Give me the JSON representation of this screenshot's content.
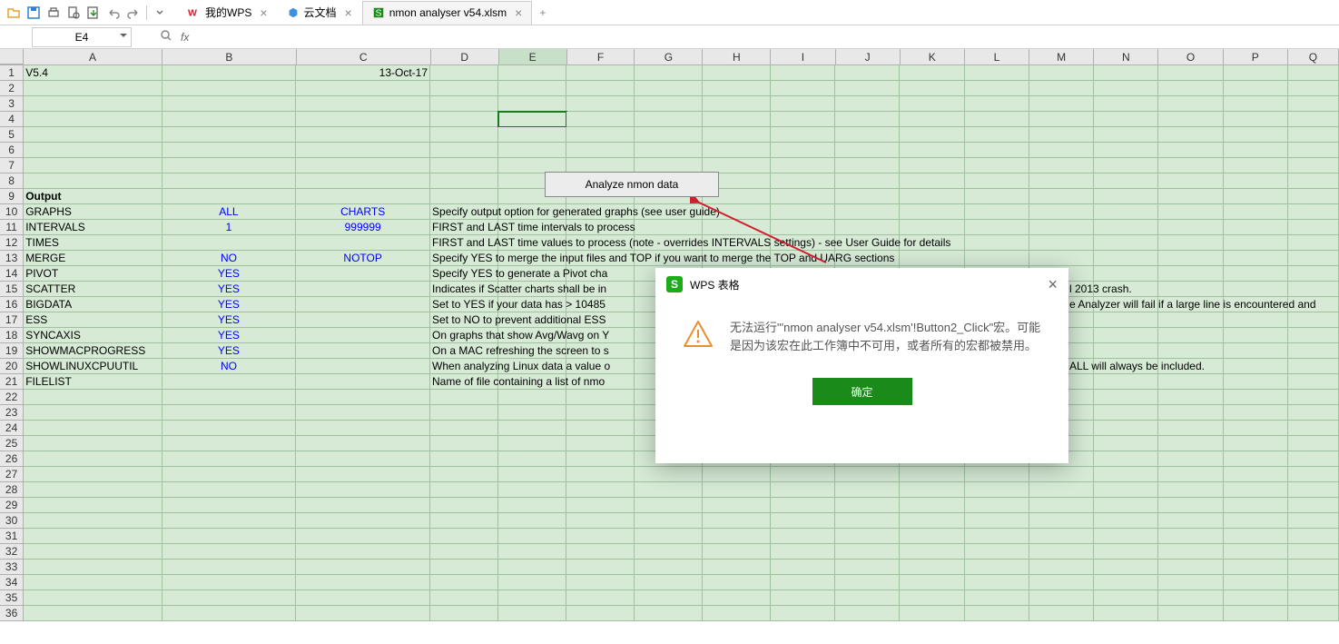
{
  "toolbar": {
    "icons": [
      "open",
      "save",
      "print",
      "export",
      "refresh",
      "undo",
      "redo"
    ]
  },
  "tabs": [
    {
      "label": "我的WPS",
      "type": "wps"
    },
    {
      "label": "云文档",
      "type": "cloud"
    },
    {
      "label": "nmon analyser v54.xlsm",
      "type": "xlsm",
      "active": true
    }
  ],
  "name_box": "E4",
  "columns": [
    "A",
    "B",
    "C",
    "D",
    "E",
    "F",
    "G",
    "H",
    "I",
    "J",
    "K",
    "L",
    "M",
    "N",
    "O",
    "P",
    "Q"
  ],
  "selected_col": "E",
  "selected_row": 4,
  "row_count": 36,
  "cells": {
    "1": {
      "A": "V5.4",
      "C": {
        "v": "13-Oct-17",
        "align": "right"
      }
    },
    "9": {
      "A": {
        "v": "Output",
        "bold": true
      }
    },
    "10": {
      "A": "GRAPHS",
      "B": {
        "v": "ALL",
        "blue": true
      },
      "C": {
        "v": "CHARTS",
        "blue": true
      },
      "D": "Specify output option for generated graphs (see user guide)"
    },
    "11": {
      "A": "INTERVALS",
      "B": {
        "v": "1",
        "blue": true
      },
      "C": {
        "v": "999999",
        "blue": true
      },
      "D": "FIRST and LAST time intervals to process"
    },
    "12": {
      "A": "TIMES",
      "D": "FIRST and LAST time values to process (note - overrides INTERVALS settings) - see User Guide for details"
    },
    "13": {
      "A": "MERGE",
      "B": {
        "v": "NO",
        "blue": true
      },
      "C": {
        "v": "NOTOP",
        "blue": true
      },
      "D": "Specify YES to merge the input files and TOP if you want to merge the TOP and UARG sections"
    },
    "14": {
      "A": "PIVOT",
      "B": {
        "v": "YES",
        "blue": true
      },
      "D": "Specify YES to generate a Pivot cha"
    },
    "15": {
      "A": "SCATTER",
      "B": {
        "v": "YES",
        "blue": true
      },
      "D": "Indicates if Scatter charts shall be in",
      "D2": "l 2013 crash."
    },
    "16": {
      "A": "BIGDATA",
      "B": {
        "v": "YES",
        "blue": true
      },
      "D": "Set to YES if your data has > 10485",
      "D2": "e Analyzer will fail if a large line is encountered and"
    },
    "17": {
      "A": "ESS",
      "B": {
        "v": "YES",
        "blue": true
      },
      "D": "Set to NO to prevent additional ESS"
    },
    "18": {
      "A": "SYNCAXIS",
      "B": {
        "v": "YES",
        "blue": true
      },
      "D": "On graphs that show Avg/Wavg on Y"
    },
    "19": {
      "A": "SHOWMACPROGRESS",
      "B": {
        "v": "YES",
        "blue": true
      },
      "D": "On a MAC refreshing the screen to s"
    },
    "20": {
      "A": "SHOWLINUXCPUUTIL",
      "B": {
        "v": "NO",
        "blue": true
      },
      "D": "When analyzing Linux data a value o",
      "D2": "ALL will always be included."
    },
    "21": {
      "A": "FILELIST",
      "D": "Name of file containing a list of nmo"
    }
  },
  "analyze_button": "Analyze nmon data",
  "dialog": {
    "title": "WPS 表格",
    "icon_text": "S",
    "message": "无法运行\"'nmon analyser v54.xlsm'!Button2_Click\"宏。可能是因为该宏在此工作簿中不可用，或者所有的宏都被禁用。",
    "ok": "确定"
  }
}
